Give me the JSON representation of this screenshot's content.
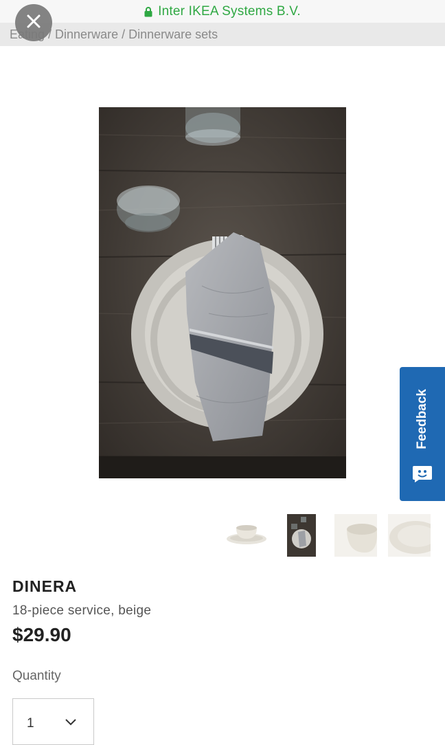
{
  "browser": {
    "site_name": "Inter IKEA Systems B.V.",
    "secure_color": "#2fa843",
    "lock_icon": "lock-icon",
    "close_icon": "close-icon"
  },
  "breadcrumb": {
    "items": [
      "Eating",
      "Dinnerware",
      "Dinnerware sets"
    ],
    "separator": "/",
    "text": "Eating / Dinnerware / Dinnerware sets"
  },
  "product": {
    "name": "DINERA",
    "description": "18-piece service, beige",
    "price": "$29.90",
    "quantity_label": "Quantity",
    "quantity_value": "1"
  },
  "feedback": {
    "label": "Feedback",
    "color": "#1f69b3",
    "icon": "smile-chat-icon"
  },
  "thumbnails": [
    {
      "name": "cup-and-saucer"
    },
    {
      "name": "table-setting",
      "selected": true
    },
    {
      "name": "bowl"
    },
    {
      "name": "plate"
    }
  ]
}
